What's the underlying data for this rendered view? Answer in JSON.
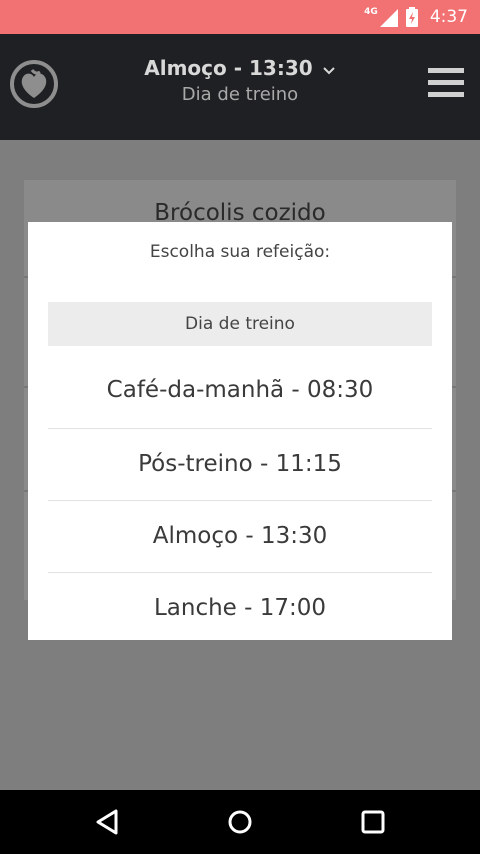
{
  "status_bar": {
    "network": "4G",
    "time": "4:37",
    "color": "#f27172"
  },
  "app_bar": {
    "title": "Almoço - 13:30",
    "subtitle": "Dia de treino",
    "background": "#1f2023"
  },
  "background_content": {
    "card_title": "Brócolis cozido"
  },
  "dialog": {
    "title": "Escolha sua refeição:",
    "section_header": "Dia de treino",
    "meals": [
      "Café-da-manhã - 08:30",
      "Pós-treino - 11:15",
      "Almoço - 13:30",
      "Lanche - 17:00"
    ]
  },
  "nav_bar": {
    "icons": [
      "back-icon",
      "home-icon",
      "recents-icon"
    ]
  }
}
